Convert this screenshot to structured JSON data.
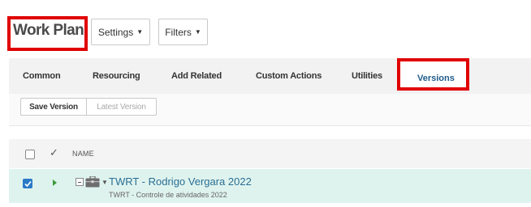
{
  "header": {
    "title": "Work Plan",
    "settings_label": "Settings",
    "filters_label": "Filters"
  },
  "ribbon": {
    "tabs": [
      "Common",
      "Resourcing",
      "Add Related",
      "Custom Actions",
      "Utilities",
      "Versions"
    ],
    "active_tab": "Versions",
    "save_version_label": "Save Version",
    "latest_version_label": "Latest Version"
  },
  "grid": {
    "columns": [
      "NAME"
    ],
    "rows": [
      {
        "selected": true,
        "title": "TWRT - Rodrigo Vergara 2022",
        "subtitle": "TWRT - Controle de atividades 2022"
      }
    ]
  },
  "colors": {
    "highlight_border": "#e00000",
    "active_tab_text": "#1e5c8a",
    "row_background": "#dff3ee",
    "row_title": "#2a6f94"
  },
  "icons": {
    "play": "play-icon",
    "collapse": "collapse-icon",
    "briefcase": "briefcase-icon",
    "check": "check-icon",
    "caret": "caret-down-icon"
  }
}
